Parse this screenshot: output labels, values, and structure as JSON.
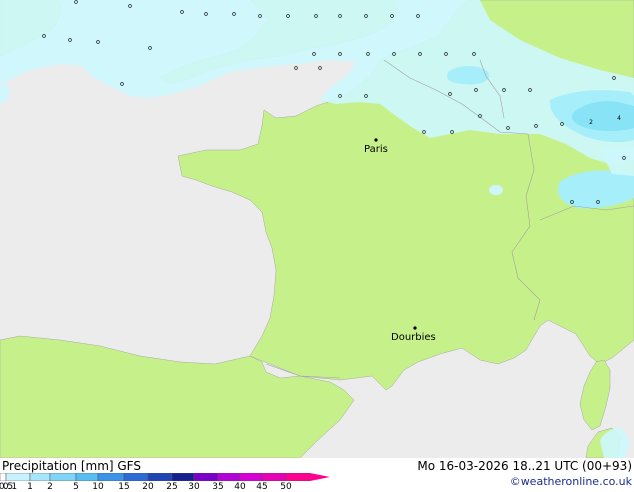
{
  "map": {
    "cities": [
      {
        "name": "Paris"
      },
      {
        "name": "Dourbies"
      }
    ],
    "precip_values": [
      "2",
      "4"
    ]
  },
  "legend": {
    "title": "Precipitation [mm]  GFS",
    "ticks": [
      "0.1",
      "0.5",
      "1",
      "2",
      "5",
      "10",
      "15",
      "20",
      "25",
      "30",
      "35",
      "40",
      "45",
      "50"
    ],
    "colors": [
      "#ffffff",
      "#c8f2ff",
      "#a6e6fc",
      "#7fd4f8",
      "#58bdf2",
      "#3a93e6",
      "#2c6ad4",
      "#1f44b4",
      "#14208e",
      "#7a00c8",
      "#b200d6",
      "#d600d6",
      "#e600b6",
      "#ff0090"
    ]
  },
  "footer": {
    "run_info": "Mo 16-03-2026 18..21 UTC (00+93)",
    "credit": "©weatheronline.co.uk"
  },
  "colors": {
    "land": "#c6f18a",
    "sea": "#ececec",
    "rain_light": "#cdf7fc",
    "rain_medium": "#a6eefa",
    "rain_heavy": "#88e3f6"
  }
}
